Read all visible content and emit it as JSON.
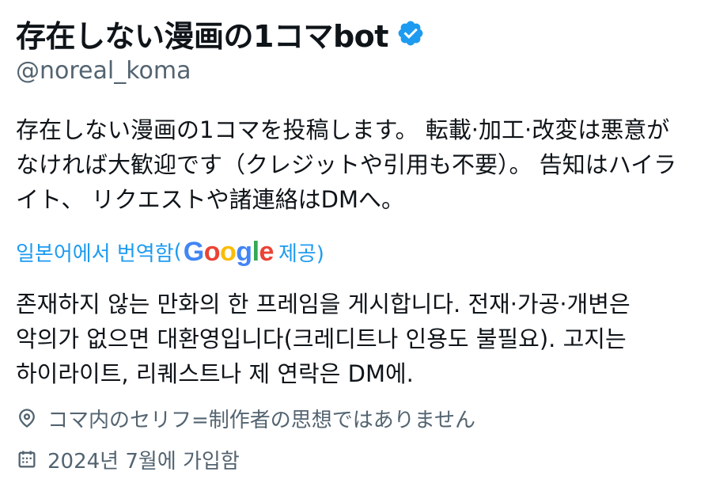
{
  "profile": {
    "display_name": "存在しない漫画の1コマbot",
    "handle": "@noreal_koma",
    "verified_icon": "verified-badge-icon",
    "bio_lines": [
      "存在しない漫画の1コマを投稿します。 転載·加工·改変は悪意が",
      "なければ大歓迎です（クレジットや引用も不要）。 告知はハイラ",
      "イト、 リクエストや諸連絡はDMへ。"
    ],
    "translate": {
      "prefix": "일본어에서 번역함",
      "open_paren": "(",
      "google_letters": [
        "G",
        "o",
        "o",
        "g",
        "l",
        "e"
      ],
      "suffix": " 제공)"
    },
    "translation_lines": [
      "존재하지 않는 만화의 한 프레임을 게시합니다. 전재·가공·개변은",
      "악의가 없으면 대환영입니다(크레디트나 인용도 불필요). 고지는",
      "하이라이트, 리퀘스트나 제 연락은 DM에."
    ],
    "location": {
      "icon": "location-pin-icon",
      "text": "コマ内のセリフ=制作者の思想ではありません"
    },
    "joined": {
      "icon": "calendar-icon",
      "text": "2024년 7월에 가입함"
    }
  },
  "colors": {
    "text_primary": "#0f1419",
    "text_secondary": "#536471",
    "link": "#1d9bf0",
    "verified": "#1d9bf0"
  }
}
